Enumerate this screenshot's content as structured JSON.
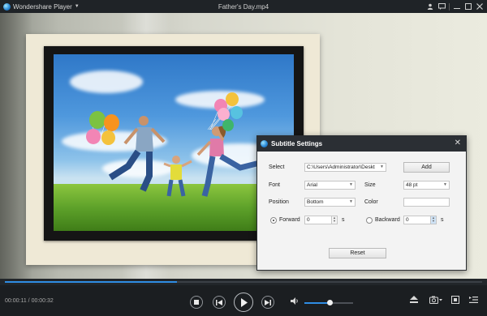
{
  "app": {
    "name": "Wondershare Player",
    "file_title": "Father's Day.mp4"
  },
  "titlebar": {
    "icons": [
      "user-icon",
      "chat-icon",
      "minimize-icon",
      "maximize-icon",
      "close-icon"
    ]
  },
  "player": {
    "time_display": "00:00:11 / 00:00:32",
    "progress_fraction": 0.36,
    "volume_fraction": 0.52,
    "accent_color": "#2f8de4"
  },
  "dialog": {
    "title": "Subtitle Settings",
    "select_label": "Select",
    "select_value": "C:\\Users\\Administrator\\Deskt",
    "add_button": "Add",
    "font_label": "Font",
    "font_value": "Arial",
    "size_label": "Size",
    "size_value": "48 pt",
    "position_label": "Position",
    "position_value": "Bottom",
    "color_label": "Color",
    "color_value": "#ffffff",
    "forward_label": "Forward",
    "forward_value": "0",
    "backward_label": "Backward",
    "backward_value": "0",
    "seconds_unit": "s",
    "reset_button": "Reset"
  }
}
